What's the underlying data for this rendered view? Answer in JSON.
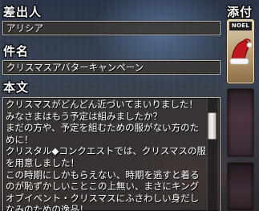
{
  "mail": {
    "sender_label": "差出人",
    "sender_value": "アリシア",
    "subject_label": "件名",
    "subject_value": "クリスマスアバターキャンペーン",
    "body_label": "本文",
    "body_text": "クリスマスがどんどん近づいてまいりました！みなさまはもう予定は組みましたか？\nまだの方や、予定を組むための服がない方のために！\nクリスタル◆コンクエストでは、クリスマスの服を用意しました！\nこの時期にしかもらえない、時期を逃すと着るのが恥ずかしいことこの上無い、まさにキングオブイベント・クリスマスにふさわしい身だしなみのための逸品！"
  },
  "attachments": {
    "label": "添付",
    "items": [
      {
        "tag": "NOEL",
        "icon": "santa-hat-icon"
      }
    ]
  },
  "colors": {
    "field_border": "#b9b2a5",
    "field_background": "#3c3732",
    "hat_red": "#c0161e",
    "attachment_slot": "#b99d73"
  }
}
